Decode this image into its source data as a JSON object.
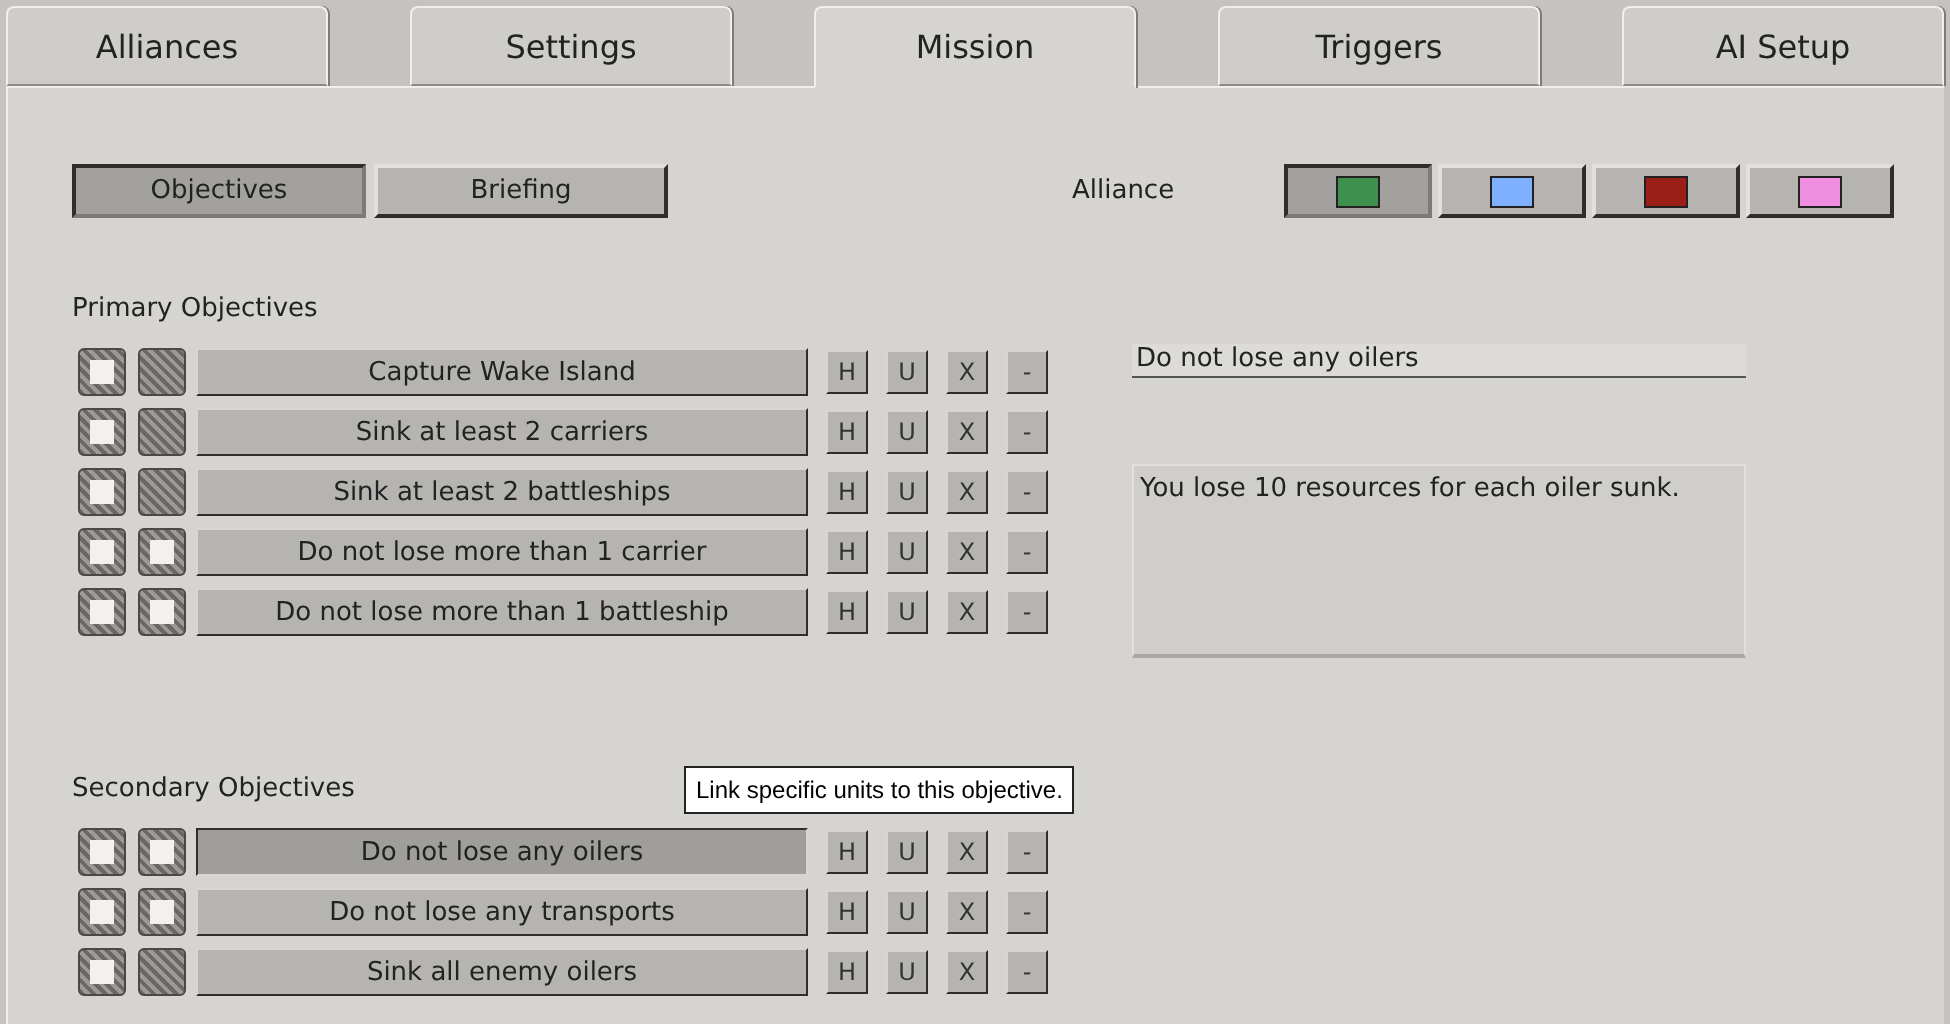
{
  "tabs": [
    {
      "label": "Alliances",
      "selected": false
    },
    {
      "label": "Settings",
      "selected": false
    },
    {
      "label": "Mission",
      "selected": true
    },
    {
      "label": "Triggers",
      "selected": false
    },
    {
      "label": "AI Setup",
      "selected": false
    }
  ],
  "view_buttons": [
    {
      "label": "Objectives",
      "selected": true
    },
    {
      "label": "Briefing",
      "selected": false
    }
  ],
  "alliance": {
    "label": "Alliance",
    "options": [
      {
        "color": "#3f8f4f",
        "selected": true
      },
      {
        "color": "#7fb0ff",
        "selected": false
      },
      {
        "color": "#9a1f16",
        "selected": false
      },
      {
        "color": "#f08ee0",
        "selected": false
      }
    ]
  },
  "primary_objectives": {
    "heading": "Primary Objectives",
    "rows": [
      {
        "checked_1": true,
        "checked_2": false,
        "name": "Capture Wake Island",
        "selected": false,
        "actions": [
          "H",
          "U",
          "X",
          "-"
        ]
      },
      {
        "checked_1": true,
        "checked_2": false,
        "name": "Sink at least 2 carriers",
        "selected": false,
        "actions": [
          "H",
          "U",
          "X",
          "-"
        ]
      },
      {
        "checked_1": true,
        "checked_2": false,
        "name": "Sink at least 2 battleships",
        "selected": false,
        "actions": [
          "H",
          "U",
          "X",
          "-"
        ]
      },
      {
        "checked_1": true,
        "checked_2": true,
        "name": "Do not lose more than 1 carrier",
        "selected": false,
        "actions": [
          "H",
          "U",
          "X",
          "-"
        ]
      },
      {
        "checked_1": true,
        "checked_2": true,
        "name": "Do not lose more than 1 battleship",
        "selected": false,
        "actions": [
          "H",
          "U",
          "X",
          "-"
        ]
      }
    ]
  },
  "secondary_objectives": {
    "heading": "Secondary Objectives",
    "rows": [
      {
        "checked_1": true,
        "checked_2": true,
        "name": "Do not lose any oilers",
        "selected": true,
        "actions": [
          "H",
          "U",
          "X",
          "-"
        ]
      },
      {
        "checked_1": true,
        "checked_2": true,
        "name": "Do not lose any transports",
        "selected": false,
        "actions": [
          "H",
          "U",
          "X",
          "-"
        ]
      },
      {
        "checked_1": true,
        "checked_2": false,
        "name": "Sink all enemy oilers",
        "selected": false,
        "actions": [
          "H",
          "U",
          "X",
          "-"
        ]
      }
    ]
  },
  "details": {
    "title": "Do not lose any oilers",
    "description": "You lose 10 resources for each oiler sunk."
  },
  "tooltip": "Link specific units to this objective."
}
